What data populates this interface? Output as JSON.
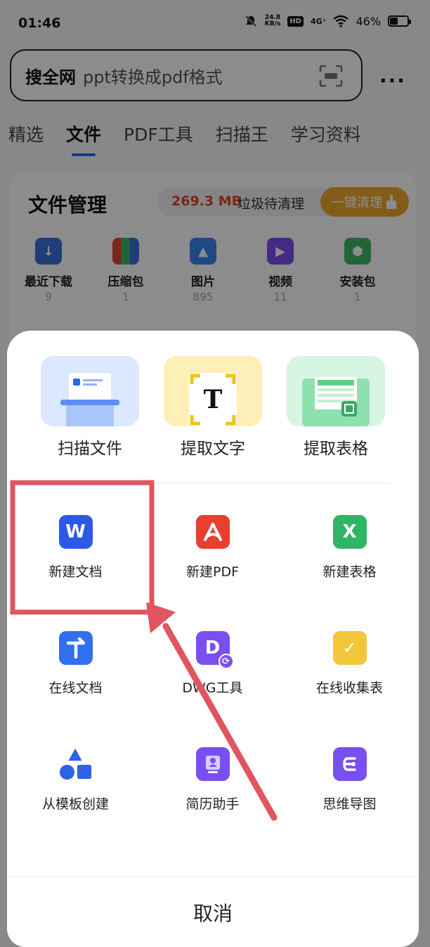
{
  "status_bar": {
    "time": "01:46",
    "speed_value": "24.8",
    "speed_unit": "KB/s",
    "hd": "HD",
    "network": "4G⁺",
    "battery": "46%",
    "battery_level": 0.46
  },
  "search": {
    "brand": "搜全网",
    "query": "ppt转换成pdf格式"
  },
  "tabs": [
    {
      "label": "精选"
    },
    {
      "label": "文件"
    },
    {
      "label": "PDF工具"
    },
    {
      "label": "扫描王"
    },
    {
      "label": "学习资料"
    }
  ],
  "file_manager": {
    "title": "文件管理",
    "junk_size": "269.3 MB",
    "junk_text": "垃圾待清理",
    "clean_button": "一键清理",
    "categories": [
      {
        "label": "最近下载",
        "count": "9",
        "color": "#3b6fe0",
        "icon": "download-icon"
      },
      {
        "label": "压缩包",
        "count": "1",
        "color": "#e0452f",
        "icon": "archive-icon"
      },
      {
        "label": "图片",
        "count": "895",
        "color": "#3a86f0",
        "icon": "image-icon"
      },
      {
        "label": "视频",
        "count": "11",
        "color": "#7a4ff0",
        "icon": "video-icon"
      },
      {
        "label": "安装包",
        "count": "1",
        "color": "#3fb86a",
        "icon": "android-icon"
      }
    ]
  },
  "sheet": {
    "top_tools": [
      {
        "label": "扫描文件",
        "icon": "scan-document-icon"
      },
      {
        "label": "提取文字",
        "icon": "extract-text-icon"
      },
      {
        "label": "提取表格",
        "icon": "extract-table-icon"
      }
    ],
    "grid": [
      {
        "label": "新建文档",
        "icon": "word-icon",
        "color": "#2c59e8",
        "glyph": "W"
      },
      {
        "label": "新建PDF",
        "icon": "pdf-icon",
        "color": "#e6402f",
        "glyph": "A"
      },
      {
        "label": "新建表格",
        "icon": "excel-icon",
        "color": "#2fb565",
        "glyph": "X"
      },
      {
        "label": "在线文档",
        "icon": "online-doc-icon",
        "color": "#2f6ff0",
        "glyph": "↑"
      },
      {
        "label": "DWG工具",
        "icon": "dwg-icon",
        "color": "#7a4ff0",
        "glyph": "D"
      },
      {
        "label": "在线收集表",
        "icon": "form-collect-icon",
        "color": "#f2c63a",
        "glyph": "✓"
      },
      {
        "label": "从模板创建",
        "icon": "template-icon",
        "color": "#2f62e8",
        "glyph": ""
      },
      {
        "label": "简历助手",
        "icon": "resume-icon",
        "color": "#7a4ff0",
        "glyph": "👤"
      },
      {
        "label": "思维导图",
        "icon": "mindmap-icon",
        "color": "#7a4ff0",
        "glyph": "⊂"
      }
    ],
    "cancel": "取消"
  },
  "annotation_color": "#e05560"
}
